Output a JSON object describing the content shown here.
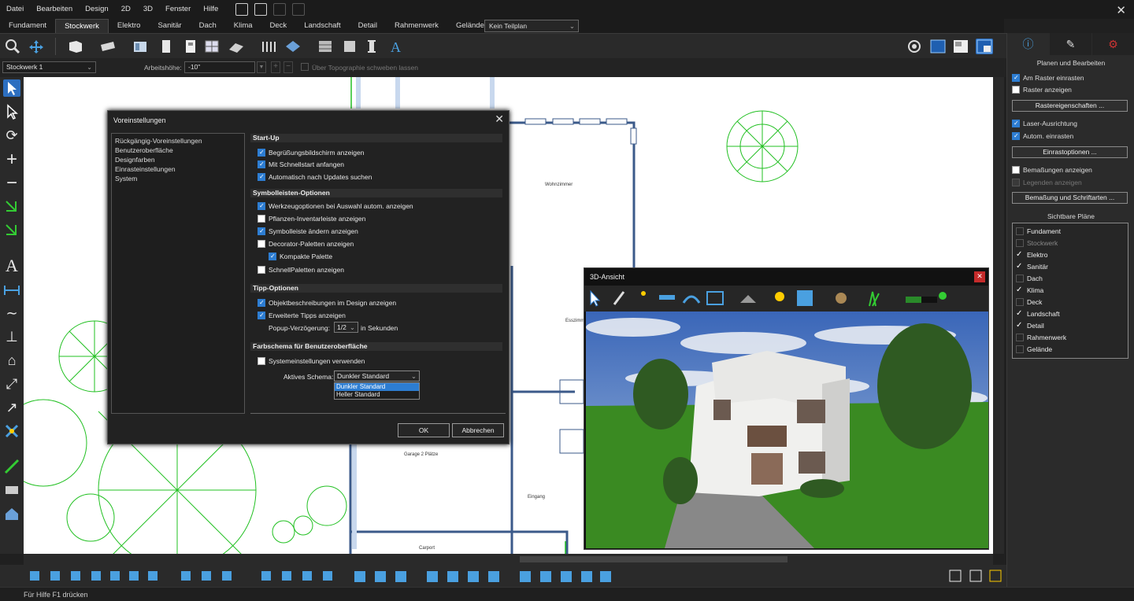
{
  "menu": [
    "Datei",
    "Bearbeiten",
    "Design",
    "2D",
    "3D",
    "Fenster",
    "Hilfe"
  ],
  "tabs": [
    "Fundament",
    "Stockwerk",
    "Elektro",
    "Sanitär",
    "Dach",
    "Klima",
    "Deck",
    "Landschaft",
    "Detail",
    "Rahmenwerk",
    "Gelände"
  ],
  "active_tab": "Stockwerk",
  "teilplan": "Kein Teilplan",
  "options_bar": {
    "floor": "Stockwerk 1",
    "height_label": "Arbeitshöhe:",
    "height_value": "-10\"",
    "topo_label": "Über Topographie schweben lassen"
  },
  "status": "Für Hilfe F1 drücken",
  "right_panel": {
    "heading": "Planen und Bearbeiten",
    "snap_grid": "Am Raster einrasten",
    "show_grid": "Raster anzeigen",
    "grid_props": "Rastereigenschaften ...",
    "laser": "Laser-Ausrichtung",
    "auto_snap": "Autom. einrasten",
    "snap_options": "Einrastoptionen ...",
    "show_dims": "Bemaßungen anzeigen",
    "show_legends": "Legenden anzeigen",
    "dims_fonts": "Bemaßung und Schriftarten ...",
    "visible_plans": "Sichtbare Pläne",
    "plans": [
      {
        "name": "Fundament",
        "on": false,
        "disabled": false
      },
      {
        "name": "Stockwerk",
        "on": false,
        "disabled": true
      },
      {
        "name": "Elektro",
        "on": true,
        "disabled": false
      },
      {
        "name": "Sanitär",
        "on": true,
        "disabled": false
      },
      {
        "name": "Dach",
        "on": false,
        "disabled": false
      },
      {
        "name": "Klima",
        "on": true,
        "disabled": false
      },
      {
        "name": "Deck",
        "on": false,
        "disabled": false
      },
      {
        "name": "Landschaft",
        "on": true,
        "disabled": false
      },
      {
        "name": "Detail",
        "on": true,
        "disabled": false
      },
      {
        "name": "Rahmenwerk",
        "on": false,
        "disabled": false
      },
      {
        "name": "Gelände",
        "on": false,
        "disabled": false
      }
    ]
  },
  "dialog": {
    "title": "Voreinstellungen",
    "nav": [
      "Rückgängig-Voreinstellungen",
      "Benutzeroberfläche",
      "Designfarben",
      "Einrasteinstellungen",
      "System"
    ],
    "startup_head": "Start-Up",
    "startup": [
      "Begrüßungsbildschirm anzeigen",
      "Mit Schnellstart anfangen",
      "Automatisch nach Updates suchen"
    ],
    "toolbar_head": "Symbolleisten-Optionen",
    "toolbar_opts": [
      "Werkzeugoptionen bei Auswahl autom. anzeigen",
      "Pflanzen-Inventarleiste anzeigen",
      "Symbolleiste ändern anzeigen",
      "Decorator-Paletten anzeigen",
      "Kompakte Palette",
      "SchnellPaletten anzeigen"
    ],
    "tips_head": "Tipp-Optionen",
    "tips": [
      "Objektbeschreibungen im Design anzeigen",
      "Erweiterte Tipps anzeigen"
    ],
    "popup_label": "Popup-Verzögerung:",
    "popup_value": "1/2",
    "popup_unit": "in Sekunden",
    "scheme_head": "Farbschema für Benutzeroberfläche",
    "system_settings": "Systemeinstellungen verwenden",
    "active_scheme_label": "Aktives Schema:",
    "active_scheme": "Dunkler Standard",
    "scheme_options": [
      "Dunkler Standard",
      "Heller Standard"
    ],
    "ok": "OK",
    "cancel": "Abbrechen"
  },
  "view3d": {
    "title": "3D-Ansicht"
  },
  "plan_labels": {
    "wohnzimmer": "Wohnzimmer",
    "esszimmer": "Esszimmer",
    "garage": "Garage 2 Plätze",
    "eingang": "Eingang",
    "carport": "Carport"
  },
  "colors": {
    "accent": "#2d7dd2",
    "plan_green": "#22c022",
    "wall_blue": "#3b5a8a"
  }
}
